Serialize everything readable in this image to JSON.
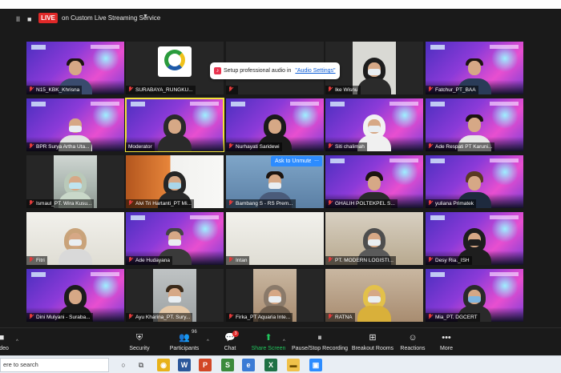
{
  "topbar": {
    "controls": [
      "II",
      "■"
    ],
    "live_badge": "LIVE",
    "live_text": "on Custom Live Streaming Service"
  },
  "popup": {
    "text": "Setup professional audio in",
    "link": "\"Audio Settings\""
  },
  "unmute": {
    "label": "Ask to Unmute",
    "more": "..."
  },
  "participants": [
    {
      "name": "N15_KBK_Khrisna"
    },
    {
      "name": "SURABAYA_RUNGKU..."
    },
    {
      "name": ""
    },
    {
      "name": "Ike Wisnu"
    },
    {
      "name": "Fatchur_PT_BAA"
    },
    {
      "name": "BPR Surya Artha Uta..."
    },
    {
      "name": "Moderator"
    },
    {
      "name": "Nurhayati Saridewi"
    },
    {
      "name": "Siti chalimah"
    },
    {
      "name": "Ade Respati PT Karuni..."
    },
    {
      "name": "Ismaul_PT. Wira Kusu..."
    },
    {
      "name": "Alvi Tri Hartanti_PT Mi..."
    },
    {
      "name": "Bambang S - RS Prem..."
    },
    {
      "name": "GHALIH POLTEKPEL S..."
    },
    {
      "name": "yuliana Primatek"
    },
    {
      "name": "Fitri"
    },
    {
      "name": "Ade Hudayana"
    },
    {
      "name": "Intan"
    },
    {
      "name": "PT. MODERN LOGISTI..."
    },
    {
      "name": "Desy Ria._ISH"
    },
    {
      "name": "Dini Mulyani - Suraba..."
    },
    {
      "name": "Ayu Kharina_PT. Sury..."
    },
    {
      "name": "Firka_PT Aquaria Inte..."
    },
    {
      "name": "RATNA"
    },
    {
      "name": "Mia_PT. DGCERT"
    }
  ],
  "controls": {
    "video": "Video",
    "security": "Security",
    "participants": "Participants",
    "participants_count": "96",
    "chat": "Chat",
    "chat_count": "3",
    "share_screen": "Share Screen",
    "pause_recording": "Pause/Stop Recording",
    "breakout_rooms": "Breakout Rooms",
    "reactions": "Reactions",
    "more": "More"
  },
  "taskbar": {
    "search_placeholder": "ere to search"
  },
  "icons": {
    "mic": "mic-off-icon",
    "security": "shield-icon",
    "participants": "people-icon",
    "chat": "chat-bubble-icon",
    "share": "share-arrow-icon",
    "record": "pause-icon",
    "breakout": "grid-icon",
    "reactions": "smiley-icon",
    "more": "ellipsis-icon"
  },
  "colors": {
    "live_red": "#e02828",
    "active_speaker": "#f2e23a",
    "share_green": "#21c55d",
    "unmute_blue": "#2d8cff"
  }
}
